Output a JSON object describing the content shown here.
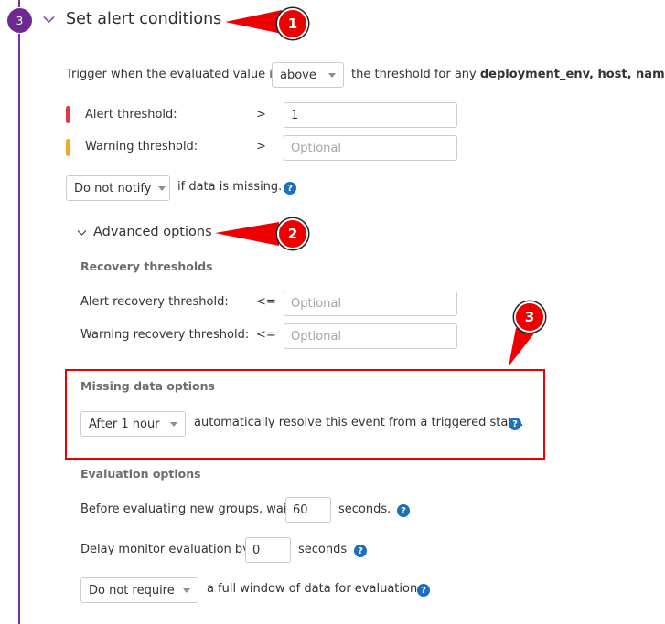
{
  "step": {
    "number": "3",
    "title": "Set alert conditions",
    "accent_color": "#6c2a91"
  },
  "trigger": {
    "prefix": "Trigger when the evaluated value is",
    "comparator": "above",
    "suffix": "the threshold for any",
    "groups": "deployment_env, host, name"
  },
  "thresholds": {
    "alert": {
      "label": "Alert threshold:",
      "op": ">",
      "value": "1",
      "color": "#e0384b"
    },
    "warning": {
      "label": "Warning threshold:",
      "op": ">",
      "placeholder": "Optional",
      "color": "#f5a623"
    }
  },
  "missing": {
    "select": "Do not notify",
    "text": "if data is missing."
  },
  "advanced": {
    "label": "Advanced options",
    "recovery": {
      "heading": "Recovery thresholds",
      "alert": {
        "label": "Alert recovery threshold:",
        "op": "<=",
        "placeholder": "Optional"
      },
      "warning": {
        "label": "Warning recovery threshold:",
        "op": "<=",
        "placeholder": "Optional"
      }
    },
    "missing_data": {
      "heading": "Missing data options",
      "select": "After 1 hour",
      "text": "automatically resolve this event from a triggered state."
    },
    "evaluation": {
      "heading": "Evaluation options",
      "wait_prefix": "Before evaluating new groups, wait",
      "wait_value": "60",
      "wait_suffix": "seconds.",
      "delay_prefix": "Delay monitor evaluation by",
      "delay_value": "0",
      "delay_suffix": "seconds",
      "window_select": "Do not require",
      "window_text": "a full window of data for evaluation."
    }
  },
  "annotations": {
    "markers": [
      "1",
      "2",
      "3"
    ],
    "color": "#ee0000"
  },
  "icons": {
    "help": "?"
  }
}
